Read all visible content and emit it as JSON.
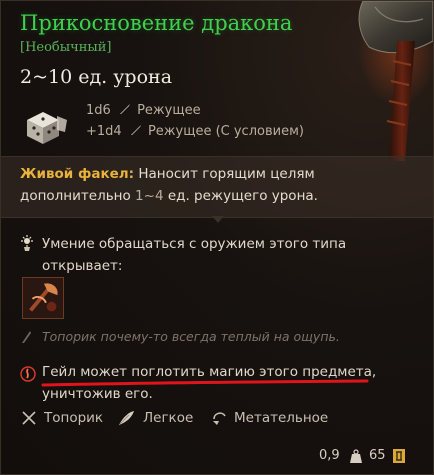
{
  "item": {
    "name": "Прикосновение дракона",
    "rarity": "[Необычный]",
    "damage_total": "2~10 ед. урона",
    "damage_lines": [
      {
        "dice": "1d6",
        "type": "Режущее"
      },
      {
        "dice": "+1d4",
        "type": "Режущее (С условием)"
      }
    ]
  },
  "passive": {
    "name": "Живой факел:",
    "text_before": " Наносит горящим целям дополнительно ",
    "range": "1~4",
    "text_after": " ед. режущего урона."
  },
  "proficiency": {
    "text": "Умение обращаться с оружием этого типа открывает:"
  },
  "flavor": {
    "text": "Топорик почему-то всегда теплый на ощупь."
  },
  "warning": {
    "text": "Гейл может поглотить магию этого предмета, уничтожив его."
  },
  "properties": [
    {
      "label": "Топорик",
      "icon": "axe-icon"
    },
    {
      "label": "Легкое",
      "icon": "feather-icon"
    },
    {
      "label": "Метательное",
      "icon": "throw-icon"
    }
  ],
  "footer": {
    "weight": "0,9",
    "price": "65"
  },
  "colors": {
    "title": "#3fd04e",
    "rarity": "#5ab35a",
    "passive_name": "#e8b23c",
    "warning_underline": "#e0141b"
  }
}
